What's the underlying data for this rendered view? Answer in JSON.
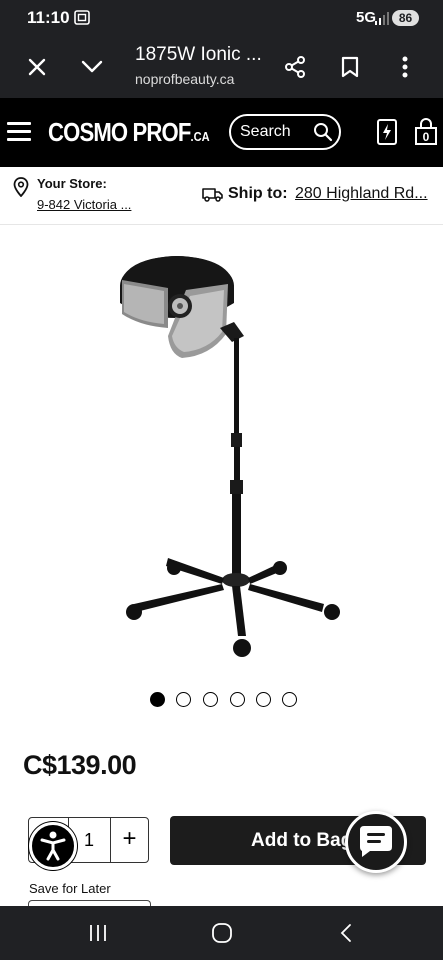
{
  "status_bar": {
    "time": "11:10",
    "network": "5G",
    "battery": "86",
    "icons": [
      "screenshot-icon",
      "signal-icon",
      "battery-icon"
    ]
  },
  "browser": {
    "page_title": "1875W Ionic ...",
    "url": "noprofbeauty.ca",
    "icons": [
      "close-icon",
      "chevron-down-icon",
      "share-icon",
      "bookmark-icon",
      "more-vert-icon"
    ]
  },
  "header": {
    "logo_main": "COSMO PROF",
    "logo_suffix": ".CA",
    "search_label": "Search",
    "icons": [
      "menu-icon",
      "search-icon",
      "quick-order-icon",
      "bag-icon"
    ],
    "bag_count": "0"
  },
  "store": {
    "your_store_label": "Your Store:",
    "your_store_value": "9-842 Victoria ...",
    "ship_to_label": "Ship to:",
    "ship_to_value": "280 Highland Rd..."
  },
  "product": {
    "image_alt": "hooded-dryer-on-stand",
    "carousel_count": 6,
    "carousel_active": 0,
    "price": "C$139.00"
  },
  "purchase": {
    "qty_value": "1",
    "qty_plus": "+",
    "add_to_bag": "Add to Bag",
    "save_for_later": "Save for Later"
  },
  "colors": {
    "brand": "#000000",
    "button": "#1c1c1c",
    "system_bar": "#202124"
  }
}
